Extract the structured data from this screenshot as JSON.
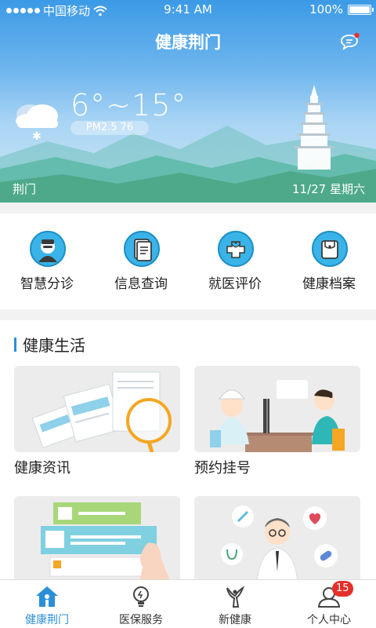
{
  "status_bar": {
    "carrier": "中国移动",
    "time": "9:41 AM",
    "battery": "100%"
  },
  "header": {
    "title": "健康荆门"
  },
  "weather": {
    "temperature": "6°~15°",
    "pm25": "PM2.5  76",
    "city": "荆门",
    "date": "11/27  星期六"
  },
  "menu": [
    {
      "label": "智慧分诊",
      "icon": "doctor-icon"
    },
    {
      "label": "信息查询",
      "icon": "document-icon"
    },
    {
      "label": "就医评价",
      "icon": "heart-cross-icon"
    },
    {
      "label": "健康档案",
      "icon": "folder-icon"
    }
  ],
  "life": {
    "title": "健康生活",
    "cards": [
      {
        "label": "健康资讯"
      },
      {
        "label": "预约挂号"
      },
      {
        "label": ""
      },
      {
        "label": ""
      }
    ]
  },
  "tabs": [
    {
      "label": "健康荆门",
      "icon": "home-icon"
    },
    {
      "label": "医保服务",
      "icon": "lightbulb-icon"
    },
    {
      "label": "新健康",
      "icon": "person-leaf-icon"
    },
    {
      "label": "个人中心",
      "icon": "user-icon"
    }
  ],
  "badge": {
    "count": "15"
  },
  "colors": {
    "accent": "#2a8fd6",
    "badge": "#e5302a",
    "icon_bg": "#3ab4e8"
  }
}
